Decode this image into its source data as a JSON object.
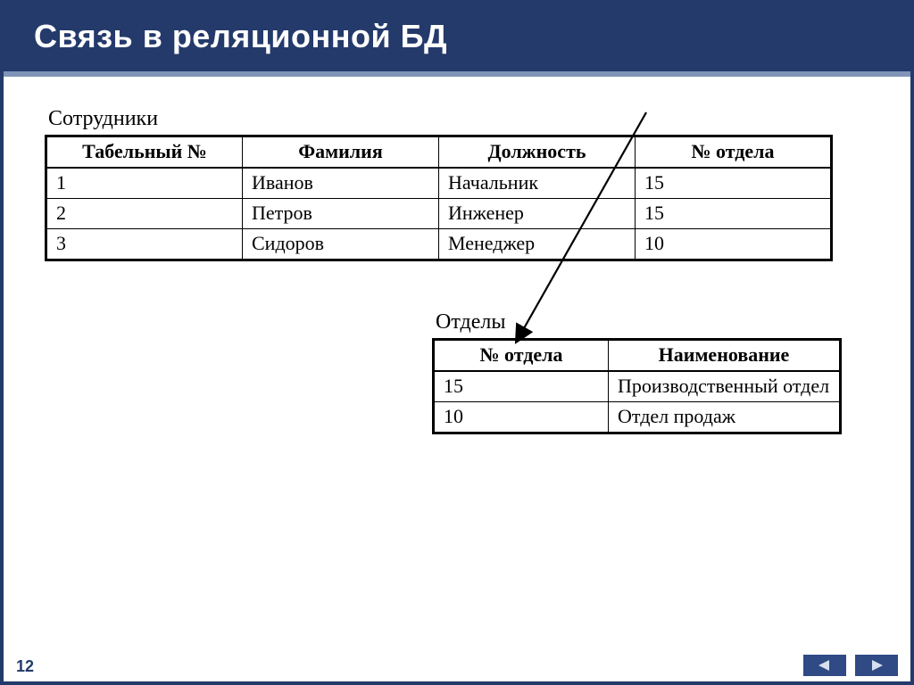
{
  "slide": {
    "title": "Связь в реляционной БД",
    "page_number": "12"
  },
  "employees": {
    "label": "Сотрудники",
    "headers": [
      "Табельный №",
      "Фамилия",
      "Должность",
      "№ отдела"
    ],
    "rows": [
      [
        "1",
        "Иванов",
        "Начальник",
        "15"
      ],
      [
        "2",
        "Петров",
        "Инженер",
        "15"
      ],
      [
        "3",
        "Сидоров",
        "Менеджер",
        "10"
      ]
    ]
  },
  "departments": {
    "label": "Отделы",
    "headers": [
      "№ отдела",
      "Наименование"
    ],
    "rows": [
      [
        "15",
        "Производственный отдел"
      ],
      [
        "10",
        "Отдел продаж"
      ]
    ]
  },
  "colors": {
    "brand": "#243a6b",
    "accent": "#8094b8",
    "nav": "#2f4a84"
  }
}
